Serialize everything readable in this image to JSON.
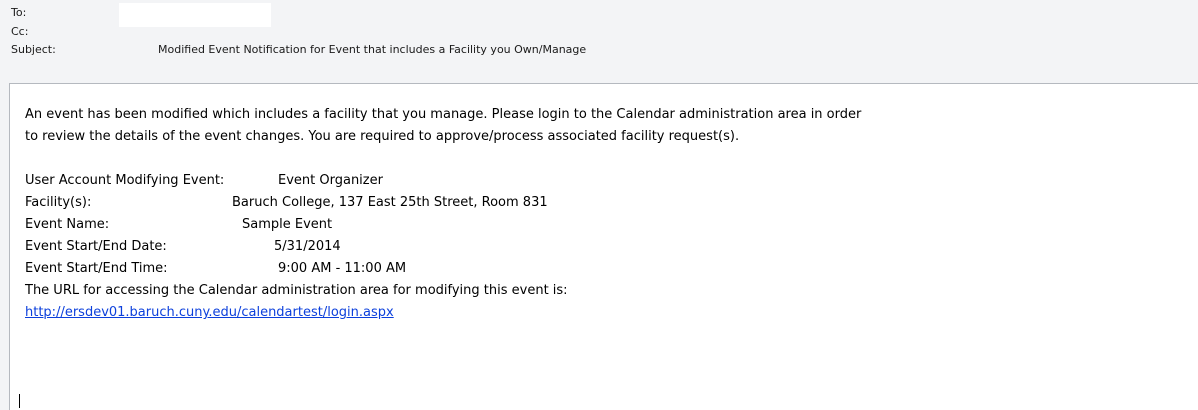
{
  "header": {
    "to_label": "To:",
    "cc_label": "Cc:",
    "subject_label": "Subject:",
    "subject_value": "Modified Event Notification for Event that includes a Facility you Own/Manage"
  },
  "body": {
    "intro_line1": "An event has been modified which includes a facility that you manage.  Please login to the Calendar administration area in order",
    "intro_line2": "to review the details of the event changes.  You are required to approve/process associated facility request(s).",
    "details": [
      {
        "label": "User Account Modifying Event:",
        "value": "Event Organizer"
      },
      {
        "label": "Facility(s):",
        "value": "Baruch College, 137 East 25th Street, Room 831"
      },
      {
        "label": "Event Name:",
        "value": "Sample Event"
      },
      {
        "label": "Event Start/End Date:",
        "value": "5/31/2014"
      },
      {
        "label": "Event Start/End Time:",
        "value": "9:00 AM - 11:00 AM"
      }
    ],
    "url_intro": "The URL for accessing the Calendar administration area for modifying this event is:",
    "url": "http://ersdev01.baruch.cuny.edu/calendartest/login.aspx"
  }
}
